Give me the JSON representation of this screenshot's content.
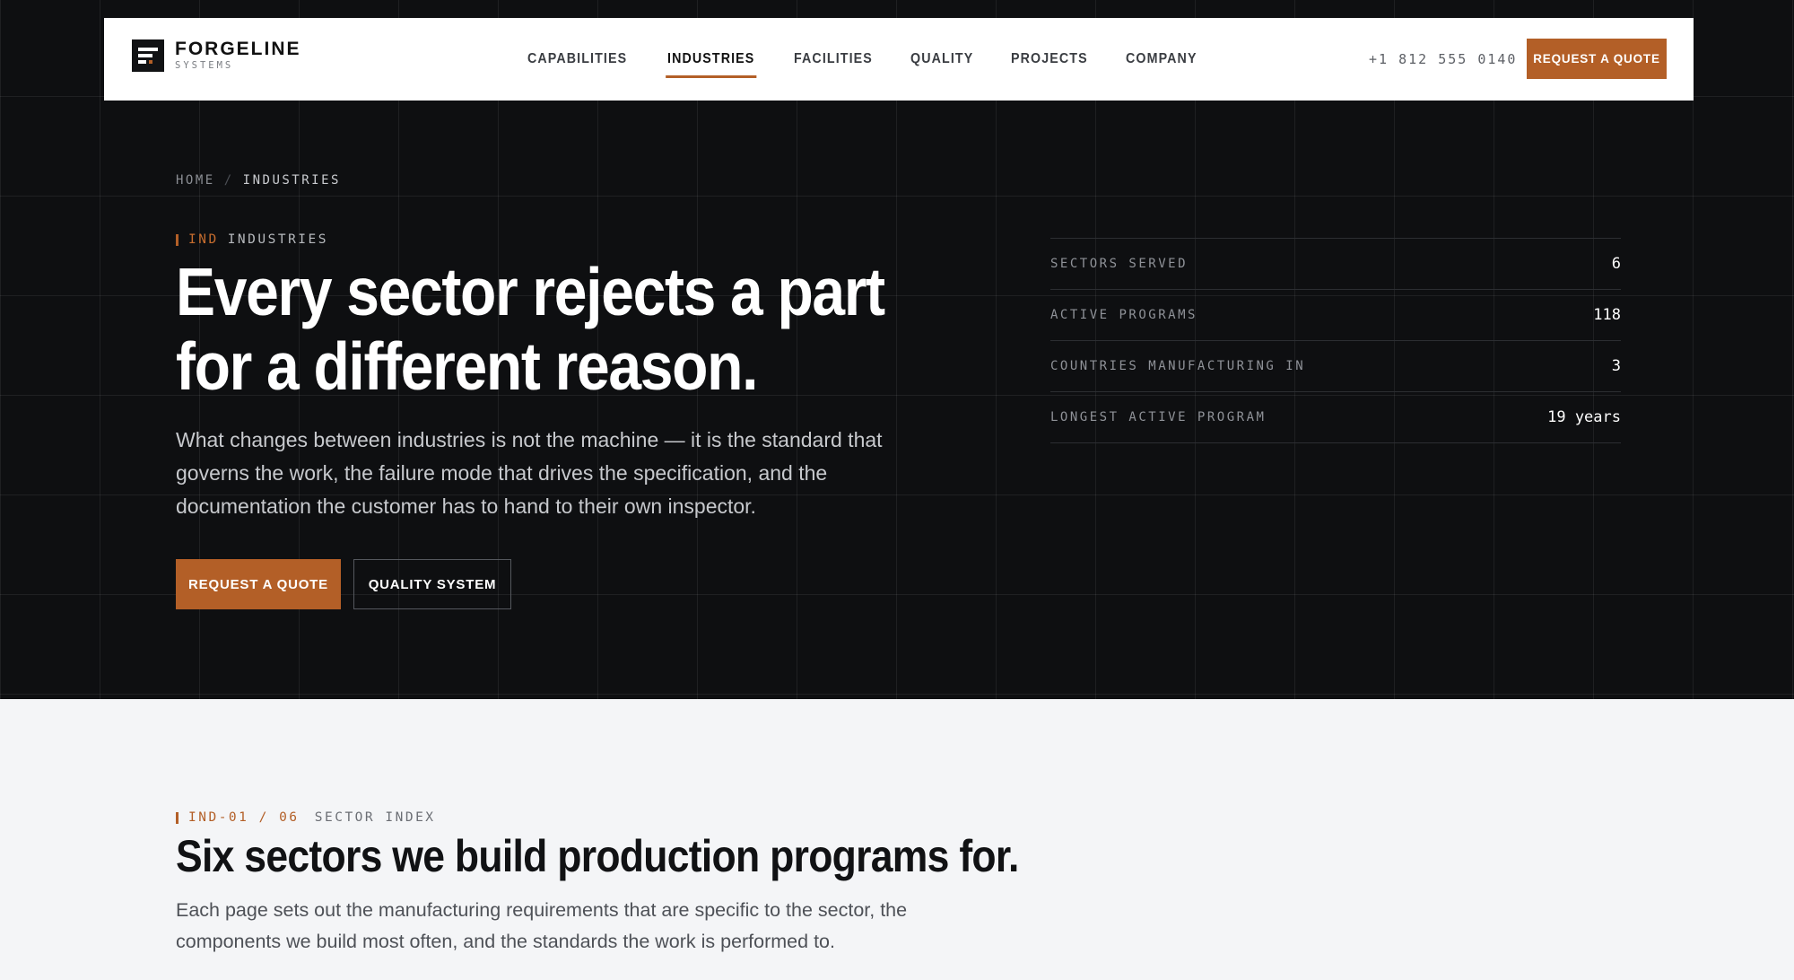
{
  "nav": {
    "logo_name": "FORGELINE",
    "logo_sub": "SYSTEMS",
    "links": [
      "CAPABILITIES",
      "INDUSTRIES",
      "FACILITIES",
      "QUALITY",
      "PROJECTS",
      "COMPANY"
    ],
    "active": "INDUSTRIES",
    "phone": "+1 812 555 0140",
    "cta": "REQUEST A QUOTE"
  },
  "hero": {
    "breadcrumb": [
      "HOME",
      "INDUSTRIES"
    ],
    "eyebrow_code": "IND",
    "eyebrow_label": "INDUSTRIES",
    "title_line1": "Every sector rejects a part",
    "title_line2": "for a different reason.",
    "description": "What changes between industries is not the machine — it is the standard that governs the work, the failure mode that drives the specification, and the documentation the customer has to hand to their own inspector.",
    "primary_button": "REQUEST A QUOTE",
    "secondary_button": "QUALITY SYSTEM"
  },
  "stats": [
    {
      "label": "SECTORS SERVED",
      "value": "6"
    },
    {
      "label": "ACTIVE PROGRAMS",
      "value": "118"
    },
    {
      "label": "COUNTRIES MANUFACTURING IN",
      "value": "3"
    },
    {
      "label": "LONGEST ACTIVE PROGRAM",
      "value": "19 years"
    }
  ],
  "sector_index": {
    "eyebrow_code": "IND-01 / 06",
    "eyebrow_label": "SECTOR INDEX",
    "title": "Six sectors we build production programs for.",
    "description": "Each page sets out the manufacturing requirements that are specific to the sector, the components we build most often, and the standards the work is performed to."
  },
  "colors": {
    "accent": "#b35f27",
    "hero_bg": "#0e0f11",
    "section_bg": "#f4f5f7"
  }
}
